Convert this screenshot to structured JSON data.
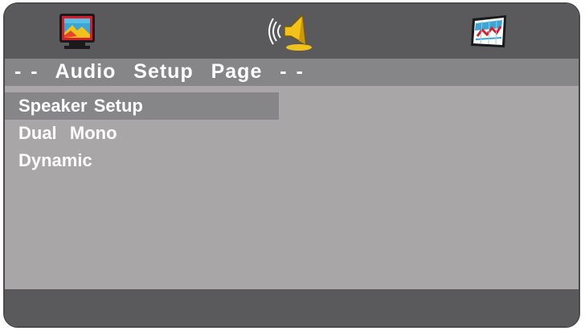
{
  "tabs": [
    {
      "name": "video-setup",
      "icon": "tv-icon",
      "active": false
    },
    {
      "name": "audio-setup",
      "icon": "speaker-icon",
      "active": true
    },
    {
      "name": "preference",
      "icon": "chart-icon",
      "active": false
    }
  ],
  "page_title": "- -  Audio  Setup  Page  - -",
  "menu": {
    "items": [
      {
        "label": "Speaker Setup",
        "selected": true
      },
      {
        "label": "Dual  Mono",
        "selected": false
      },
      {
        "label": "Dynamic",
        "selected": false
      }
    ]
  },
  "colors": {
    "topbar": "#5a595b",
    "body": "#a8a6a7",
    "highlight": "#868587",
    "text": "#ffffff"
  }
}
